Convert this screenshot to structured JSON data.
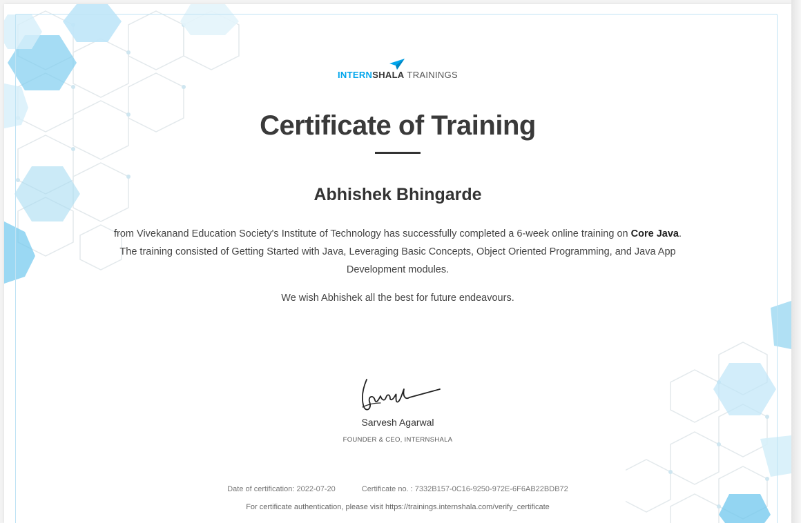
{
  "brand": {
    "part1": "INTERN",
    "part2": "SHALA",
    "part3": "TRAININGS"
  },
  "certificate": {
    "title": "Certificate of Training",
    "recipient": "Abhishek Bhingarde",
    "body_before_course": "from Vivekanand Education Society's Institute of Technology has successfully completed a 6-week online training on",
    "course": "Core Java",
    "body_after_course": ". The training consisted of Getting Started with Java, Leveraging Basic Concepts, Object Oriented Programming, and Java App Development modules.",
    "wish": "We wish Abhishek all the best for future endeavours.",
    "signature_text": "Sarvesh",
    "signer_name": "Sarvesh Agarwal",
    "signer_title": "FOUNDER & CEO, INTERNSHALA",
    "date_label": "Date of certification: 2022-07-20",
    "certificate_no": "Certificate no. : 7332B157-0C16-9250-972E-6F6AB22BDB72",
    "authentication_note": "For certificate authentication, please visit https://trainings.internshala.com/verify_certificate"
  },
  "colors": {
    "brand_blue": "#00a5ec",
    "hex_light": "#d6effa",
    "hex_mid": "#a9dcf2",
    "text_dark": "#3a3a3a"
  },
  "icons": {
    "logo": "paper-plane-icon",
    "decoration": "hexagon-pattern"
  }
}
